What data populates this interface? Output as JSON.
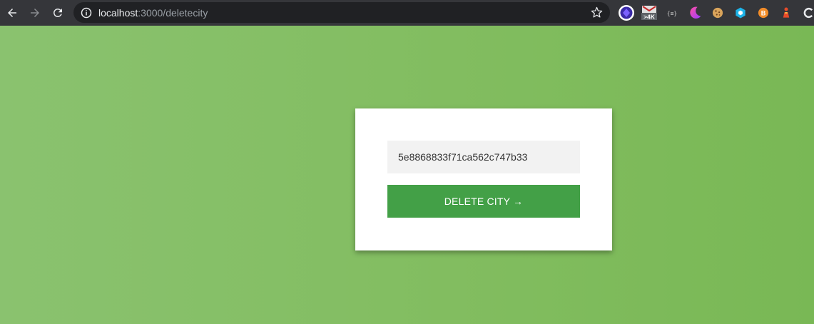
{
  "browser": {
    "url_host": "localhost",
    "url_path": ":3000/deletecity",
    "extensions": [
      "extension-purple-diamond",
      "extension-4k-badge",
      "extension-json-braces",
      "extension-moon",
      "extension-cookie",
      "extension-blue-cube",
      "extension-b-badge",
      "extension-red-figure",
      "extension-c-circle"
    ],
    "ext_4k_label": ">4K",
    "ext_json_label": "{≡}",
    "ext_b_label": "B",
    "colors": {
      "toolbar": "#35363a",
      "omnibox": "#202124"
    }
  },
  "page": {
    "background": "#82bd60"
  },
  "form": {
    "city_id_value": "5e8868833f71ca562c747b33",
    "delete_label": "DELETE CITY →",
    "button_color": "#43a047"
  }
}
